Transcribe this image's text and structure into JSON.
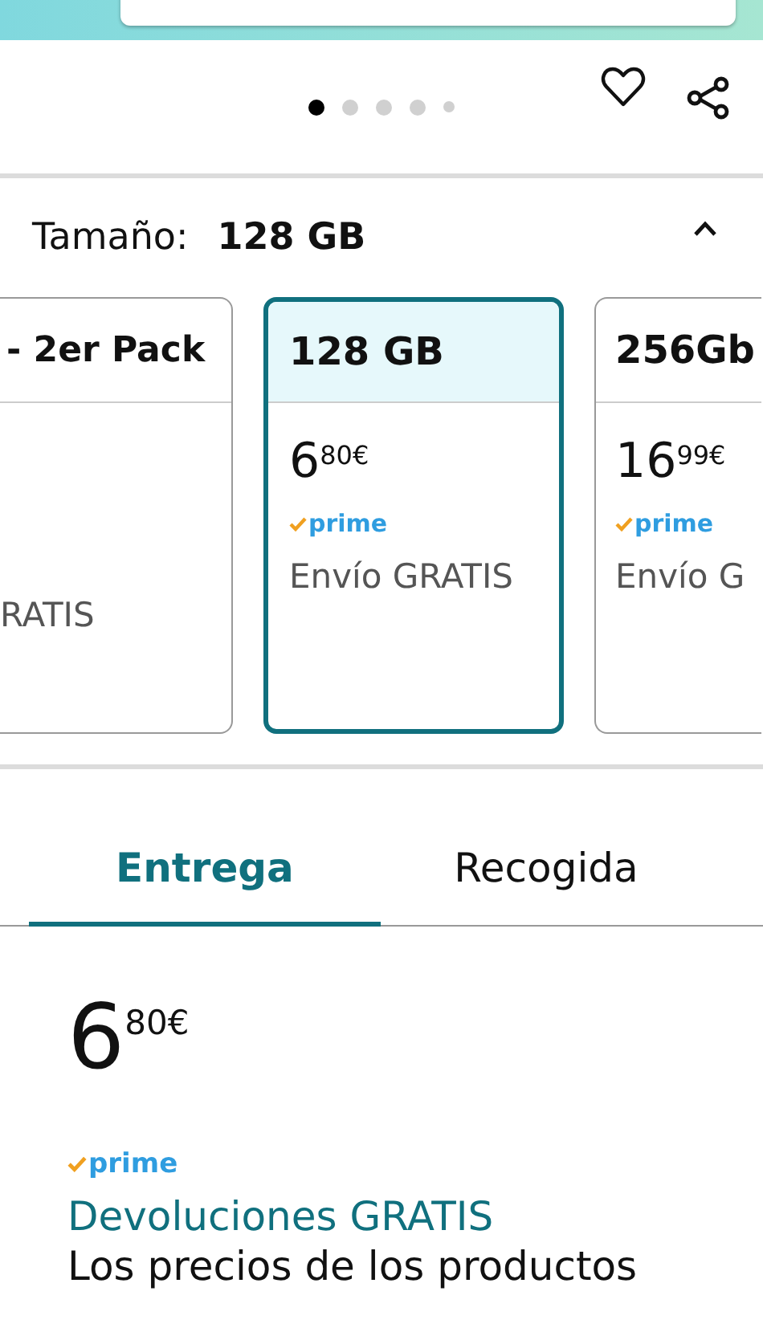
{
  "carousel": {
    "dots": [
      {
        "selected": true
      },
      {
        "selected": false
      },
      {
        "selected": false
      },
      {
        "selected": false
      },
      {
        "selected": false
      }
    ]
  },
  "size": {
    "label": "Tamaño:",
    "value": "128 GB",
    "expanded": true
  },
  "options": [
    {
      "name": "- 2er Pack",
      "shipping": "RATIS",
      "selected": false,
      "kind": "cut-left"
    },
    {
      "name": "128 GB",
      "price": {
        "whole": "6",
        "fraction": "80€"
      },
      "badge": "prime",
      "shipping": "Envío GRATIS",
      "selected": true,
      "kind": "full"
    },
    {
      "name": "256Gb",
      "price": {
        "whole": "16",
        "fraction": "99€"
      },
      "badge": "prime",
      "shipping": "Envío G",
      "selected": false,
      "kind": "cut-right"
    }
  ],
  "tabs": [
    {
      "label": "Entrega",
      "selected": true
    },
    {
      "label": "Recogida",
      "selected": false
    }
  ],
  "offer": {
    "price": {
      "whole": "6",
      "fraction": "80€"
    },
    "badge": "prime",
    "returns": "Devoluciones GRATIS",
    "note": "Los precios de los productos"
  }
}
